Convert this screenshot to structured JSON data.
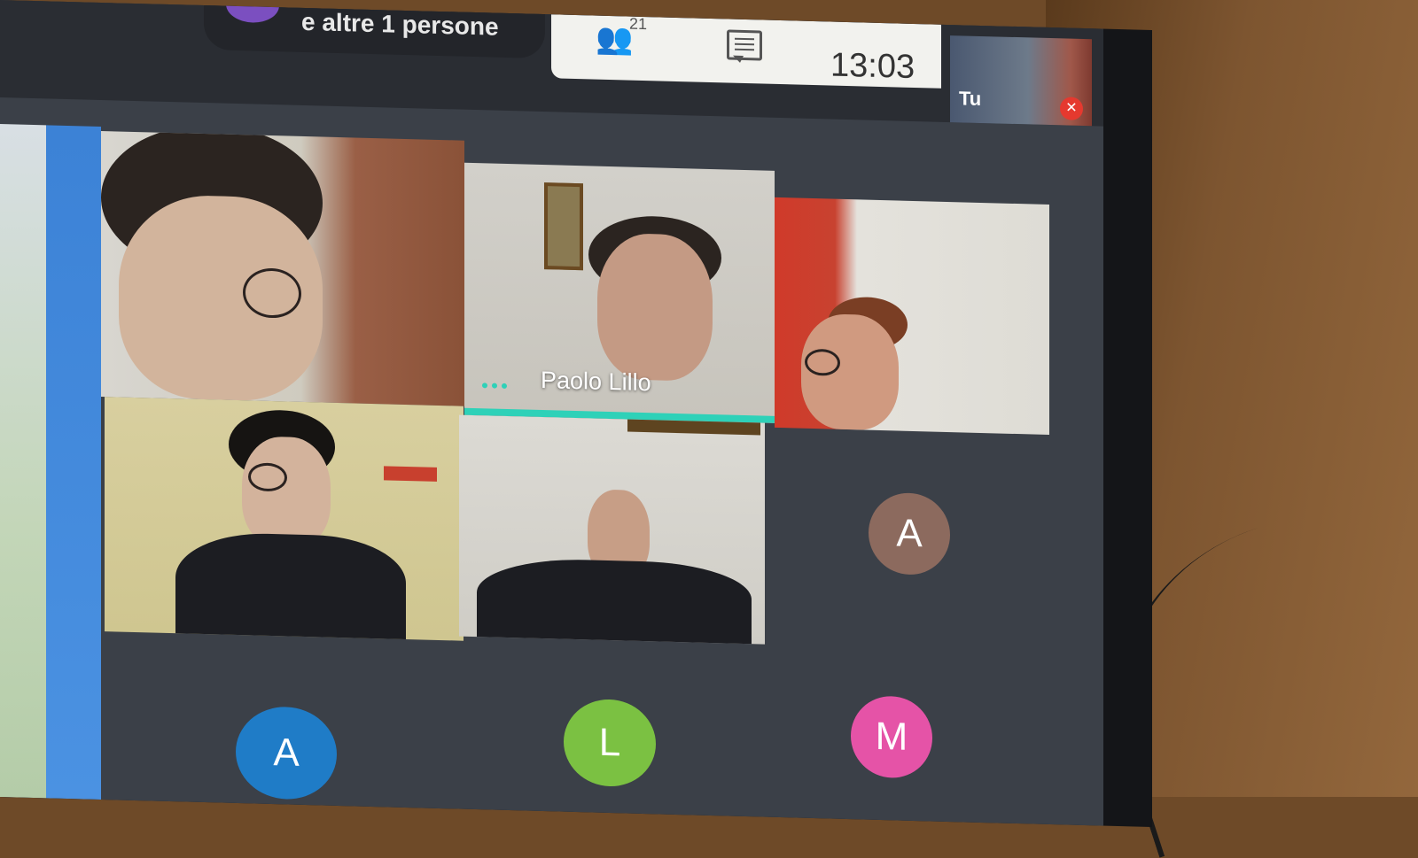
{
  "topbar": {
    "others_text": "e altre 1 persone",
    "participants_count": "21",
    "time": "13:03"
  },
  "self_view": {
    "label": "Tu"
  },
  "active_speaker": {
    "name": "Paolo Lillo"
  },
  "avatars": [
    {
      "initial": "A",
      "color": "#8c6a5e"
    },
    {
      "initial": "A",
      "color": "#1f7cc7"
    },
    {
      "initial": "L",
      "color": "#7bc142"
    },
    {
      "initial": "M",
      "color": "#e553a7"
    }
  ],
  "colors": {
    "speaker_highlight": "#2ed1b8",
    "mic_off": "#e5392f"
  }
}
